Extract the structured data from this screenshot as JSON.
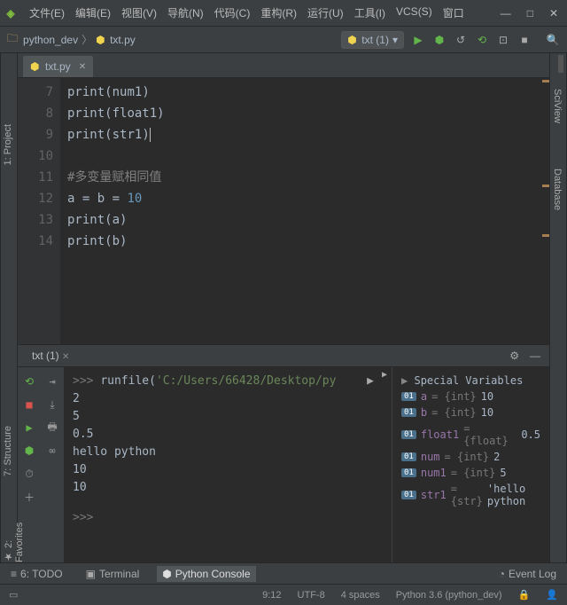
{
  "menus": [
    "文件(E)",
    "编辑(E)",
    "视图(V)",
    "导航(N)",
    "代码(C)",
    "重构(R)",
    "运行(U)",
    "工具(I)",
    "VCS(S)",
    "窗口"
  ],
  "breadcrumb": {
    "project": "python_dev",
    "file": "txt.py"
  },
  "run_config": "txt (1)",
  "editor_tab": "txt.py",
  "code_lines": [
    {
      "n": "7",
      "tokens": [
        {
          "t": "print",
          "c": "fn"
        },
        {
          "t": "(",
          "c": "par"
        },
        {
          "t": "num1",
          "c": "id"
        },
        {
          "t": ")",
          "c": "par"
        }
      ]
    },
    {
      "n": "8",
      "tokens": [
        {
          "t": "print",
          "c": "fn"
        },
        {
          "t": "(",
          "c": "par"
        },
        {
          "t": "float1",
          "c": "id"
        },
        {
          "t": ")",
          "c": "par"
        }
      ]
    },
    {
      "n": "9",
      "tokens": [
        {
          "t": "print",
          "c": "fn"
        },
        {
          "t": "(",
          "c": "par"
        },
        {
          "t": "str1",
          "c": "id"
        },
        {
          "t": ")",
          "c": "par caret"
        }
      ]
    },
    {
      "n": "10",
      "tokens": []
    },
    {
      "n": "11",
      "tokens": [
        {
          "t": "#多变量赋相同值",
          "c": "cm"
        }
      ]
    },
    {
      "n": "12",
      "tokens": [
        {
          "t": "a ",
          "c": "id"
        },
        {
          "t": "= ",
          "c": "par"
        },
        {
          "t": "b ",
          "c": "id"
        },
        {
          "t": "= ",
          "c": "par"
        },
        {
          "t": "10",
          "c": "num"
        }
      ]
    },
    {
      "n": "13",
      "tokens": [
        {
          "t": "print",
          "c": "fn"
        },
        {
          "t": "(",
          "c": "par"
        },
        {
          "t": "a",
          "c": "id"
        },
        {
          "t": ")",
          "c": "par"
        }
      ]
    },
    {
      "n": "14",
      "tokens": [
        {
          "t": "print",
          "c": "fn"
        },
        {
          "t": "(",
          "c": "par"
        },
        {
          "t": "b",
          "c": "id"
        },
        {
          "t": ")",
          "c": "par"
        }
      ]
    }
  ],
  "console_tab": "txt (1)",
  "console": {
    "prompt": ">>>",
    "run_cmd": "runfile(",
    "run_path": "'C:/Users/66428/Desktop/py",
    "out": [
      "2",
      "5",
      "0.5",
      "hello python",
      "10",
      "10"
    ],
    "prompt2": ">>>"
  },
  "vars_header": "Special Variables",
  "vars": [
    {
      "name": "a",
      "type": "{int}",
      "val": "10"
    },
    {
      "name": "b",
      "type": "{int}",
      "val": "10"
    },
    {
      "name": "float1",
      "type": "{float}",
      "val": "0.5"
    },
    {
      "name": "num",
      "type": "{int}",
      "val": "2"
    },
    {
      "name": "num1",
      "type": "{int}",
      "val": "5"
    },
    {
      "name": "str1",
      "type": "{str}",
      "val": "'hello python"
    }
  ],
  "leftrail": {
    "project": "1: Project",
    "structure": "7: Structure",
    "favorites": "2: Favorites"
  },
  "rightrail": {
    "sciview": "SciView",
    "database": "Database"
  },
  "bottom": {
    "todo": "6: TODO",
    "terminal": "Terminal",
    "console": "Python Console",
    "eventlog": "Event Log"
  },
  "status": {
    "pos": "9:12",
    "enc": "UTF-8",
    "indent": "4 spaces",
    "py": "Python 3.6 (python_dev)"
  }
}
